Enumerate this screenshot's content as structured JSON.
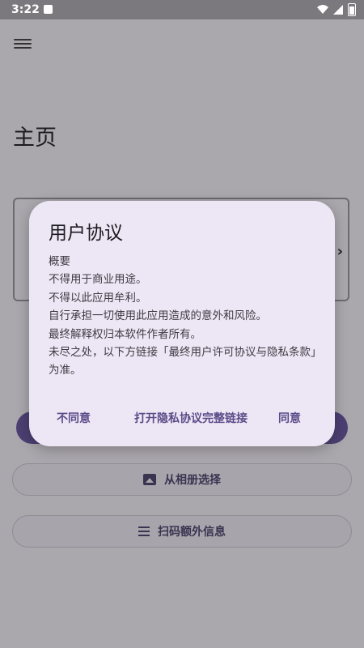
{
  "status_bar": {
    "time": "3:22",
    "icons": [
      "notification-icon",
      "wifi-icon",
      "signal-icon",
      "battery-icon"
    ]
  },
  "app": {
    "page_title": "主页",
    "menu_icon": "menu-icon"
  },
  "buttons": {
    "album_label": "从相册选择",
    "scan_label": "扫码额外信息"
  },
  "dialog": {
    "title": "用户协议",
    "body": [
      "概要",
      "不得用于商业用途。",
      "不得以此应用牟利。",
      "自行承担一切使用此应用造成的意外和风险。",
      "最终解释权归本软件作者所有。",
      "未尽之处，以下方链接「最终用户许可协议与隐私条款」为准。"
    ],
    "actions": {
      "disagree": "不同意",
      "open_link": "打开隐私协议完整链接",
      "agree": "同意"
    }
  },
  "colors": {
    "scrim": "#aaa7ad",
    "dialog_bg": "#ede7f5",
    "primary": "#4c3f72",
    "action_text": "#5a4b88"
  }
}
